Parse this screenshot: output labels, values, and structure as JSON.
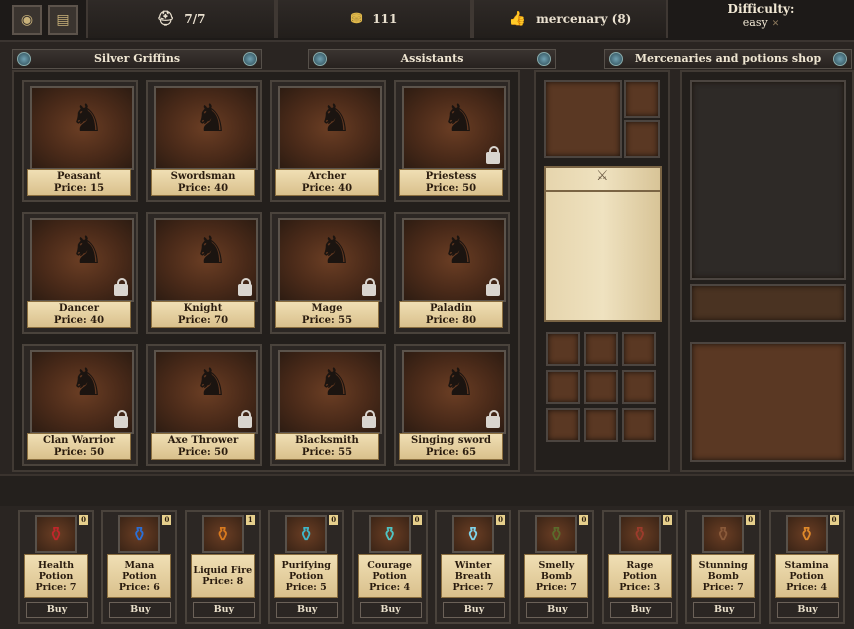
{
  "topbar": {
    "population": "7/7",
    "gold": "111",
    "reputation": "mercenary (8)",
    "difficulty_label": "Difficulty:",
    "difficulty_value": "easy"
  },
  "tabs": {
    "left": "Silver Griffins",
    "middle": "Assistants",
    "right": "Mercenaries and potions shop"
  },
  "units": [
    {
      "name": "Peasant",
      "price": "Price: 15",
      "locked": false,
      "icon": "peasant-icon"
    },
    {
      "name": "Swordsman",
      "price": "Price: 40",
      "locked": false,
      "icon": "swordsman-icon"
    },
    {
      "name": "Archer",
      "price": "Price: 40",
      "locked": false,
      "icon": "archer-icon"
    },
    {
      "name": "Priestess",
      "price": "Price: 50",
      "locked": true,
      "icon": "priestess-icon"
    },
    {
      "name": "Dancer",
      "price": "Price: 40",
      "locked": true,
      "icon": "dancer-icon"
    },
    {
      "name": "Knight",
      "price": "Price: 70",
      "locked": true,
      "icon": "knight-icon"
    },
    {
      "name": "Mage",
      "price": "Price: 55",
      "locked": true,
      "icon": "mage-icon"
    },
    {
      "name": "Paladin",
      "price": "Price: 80",
      "locked": true,
      "icon": "paladin-icon"
    },
    {
      "name": "Clan Warrior",
      "price": "Price: 50",
      "locked": true,
      "icon": "clan-warrior-icon"
    },
    {
      "name": "Axe Thrower",
      "price": "Price: 50",
      "locked": true,
      "icon": "axe-thrower-icon"
    },
    {
      "name": "Blacksmith",
      "price": "Price: 55",
      "locked": true,
      "icon": "blacksmith-icon"
    },
    {
      "name": "Singing sword",
      "price": "Price: 65",
      "locked": true,
      "icon": "singing-sword-icon"
    }
  ],
  "potions": [
    {
      "name": "Health Potion",
      "price": "Price: 7",
      "count": "0",
      "buy": "Buy",
      "color": "#c0262b"
    },
    {
      "name": "Mana Potion",
      "price": "Price: 6",
      "count": "0",
      "buy": "Buy",
      "color": "#2b6fd6"
    },
    {
      "name": "Liquid Fire",
      "price": "Price: 8",
      "count": "1",
      "buy": "Buy",
      "color": "#d97a1e"
    },
    {
      "name": "Purifying Potion",
      "price": "Price: 5",
      "count": "0",
      "buy": "Buy",
      "color": "#3fb7c9"
    },
    {
      "name": "Courage Potion",
      "price": "Price: 4",
      "count": "0",
      "buy": "Buy",
      "color": "#4fc4c4"
    },
    {
      "name": "Winter Breath",
      "price": "Price: 7",
      "count": "0",
      "buy": "Buy",
      "color": "#7fd4ea"
    },
    {
      "name": "Smelly Bomb",
      "price": "Price: 7",
      "count": "0",
      "buy": "Buy",
      "color": "#5a6b2c"
    },
    {
      "name": "Rage Potion",
      "price": "Price: 3",
      "count": "0",
      "buy": "Buy",
      "color": "#9c3b2c"
    },
    {
      "name": "Stunning Bomb",
      "price": "Price: 7",
      "count": "0",
      "buy": "Buy",
      "color": "#8a5a3a"
    },
    {
      "name": "Stamina Potion",
      "price": "Price: 4",
      "count": "0",
      "buy": "Buy",
      "color": "#e08a2a"
    }
  ]
}
